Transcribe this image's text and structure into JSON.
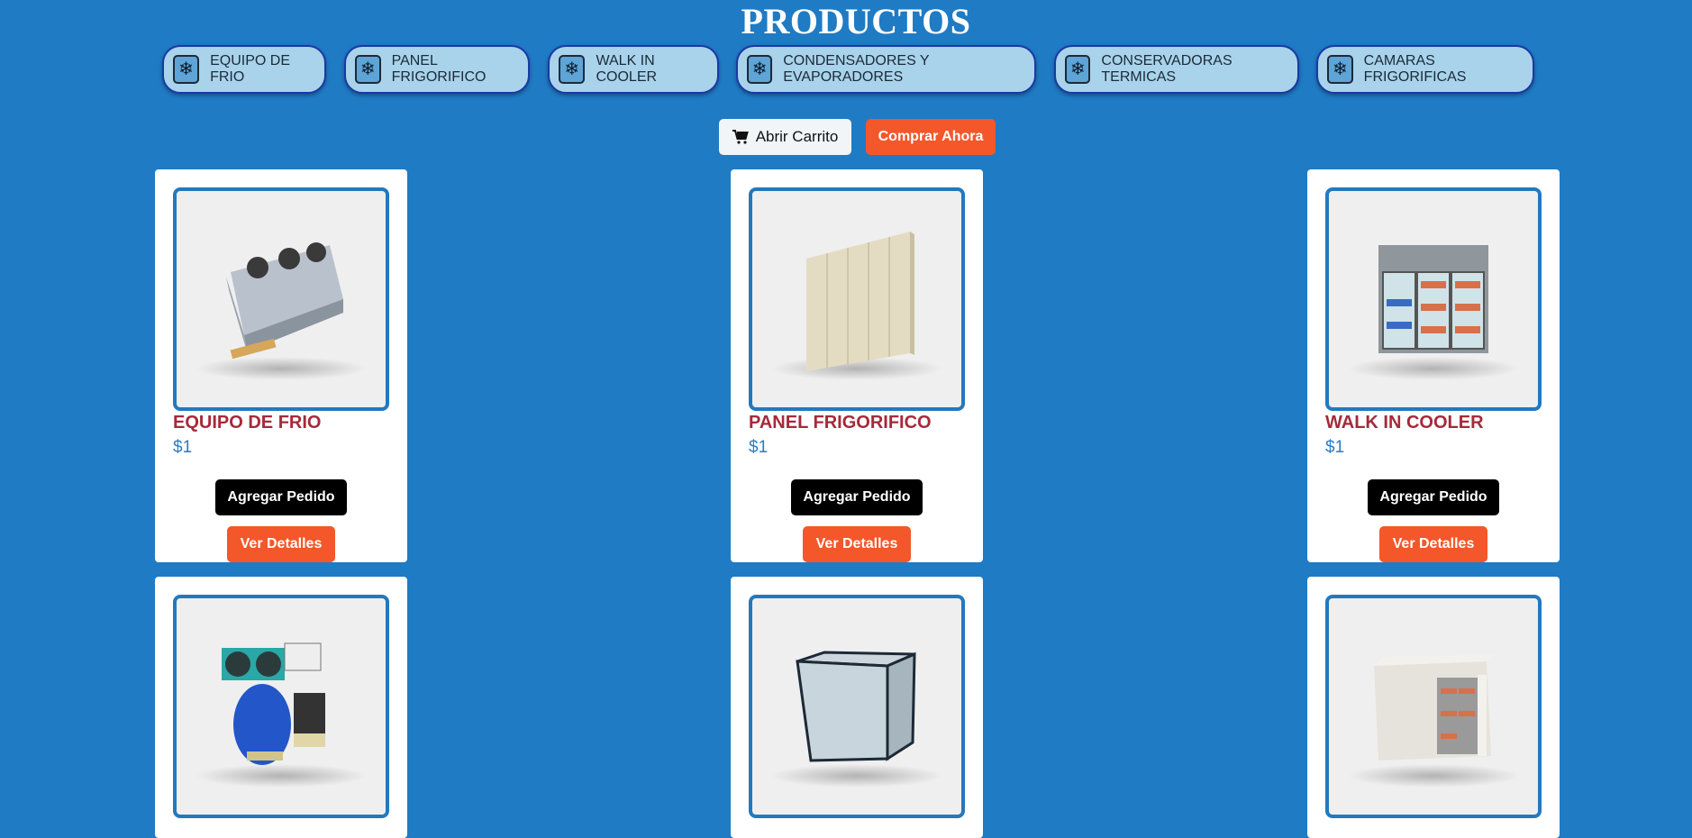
{
  "page": {
    "title": "PRODUCTOS"
  },
  "categories": [
    {
      "label": "EQUIPO DE FRIO",
      "icon": "snowflake-icon"
    },
    {
      "label": "PANEL FRIGORIFICO",
      "icon": "snowflake-icon"
    },
    {
      "label": "WALK IN COOLER",
      "icon": "snowflake-icon"
    },
    {
      "label": "CONDENSADORES Y EVAPORADORES",
      "icon": "snowflake-icon"
    },
    {
      "label": "CONSERVADORAS TERMICAS",
      "icon": "snowflake-icon"
    },
    {
      "label": "CAMARAS FRIGORIFICAS",
      "icon": "snowflake-icon"
    }
  ],
  "actions": {
    "cart_label": "Abrir Carrito",
    "cart_icon": "shopping-cart-icon",
    "buy_label": "Comprar Ahora"
  },
  "products": [
    {
      "name": "EQUIPO DE FRIO",
      "price": "$1",
      "add_label": "Agregar Pedido",
      "details_label": "Ver Detalles"
    },
    {
      "name": "PANEL FRIGORIFICO",
      "price": "$1",
      "add_label": "Agregar Pedido",
      "details_label": "Ver Detalles"
    },
    {
      "name": "WALK IN COOLER",
      "price": "$1",
      "add_label": "Agregar Pedido",
      "details_label": "Ver Detalles"
    },
    {
      "name": "",
      "price": "",
      "add_label": "",
      "details_label": ""
    },
    {
      "name": "",
      "price": "",
      "add_label": "",
      "details_label": ""
    },
    {
      "name": "",
      "price": "",
      "add_label": "",
      "details_label": ""
    }
  ],
  "colors": {
    "background": "#1f7bc4",
    "accent_orange": "#f4572a",
    "product_name": "#a52a3a",
    "price": "#2a7dc4",
    "pill_bg": "#a9d3ea",
    "pill_border": "#1939a8"
  }
}
